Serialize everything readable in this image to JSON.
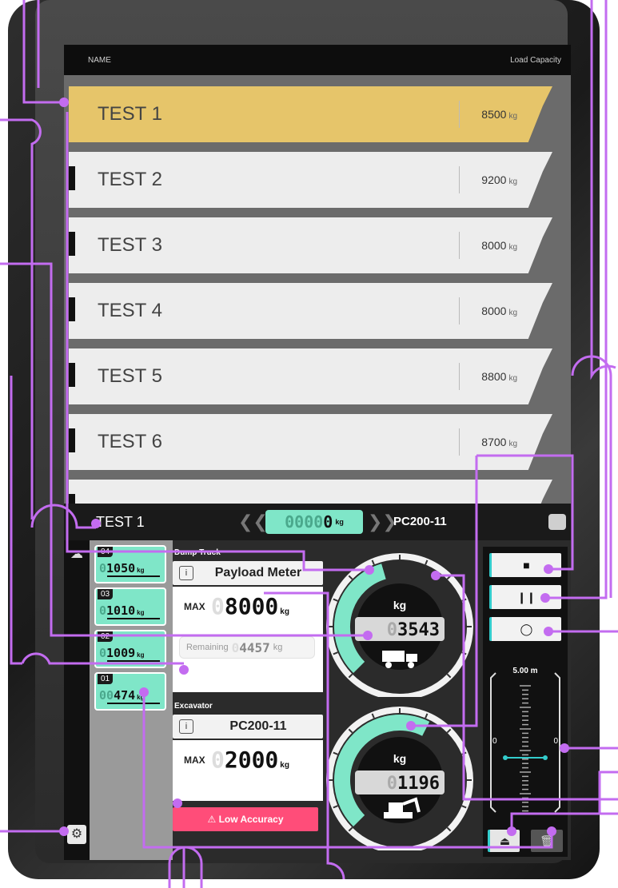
{
  "list": {
    "header_name": "NAME",
    "header_capacity": "Load Capacity",
    "unit": "kg",
    "rows": [
      {
        "name": "TEST 1",
        "capacity": "8500",
        "selected": true
      },
      {
        "name": "TEST 2",
        "capacity": "9200",
        "selected": false
      },
      {
        "name": "TEST 3",
        "capacity": "8000",
        "selected": false
      },
      {
        "name": "TEST 4",
        "capacity": "8000",
        "selected": false
      },
      {
        "name": "TEST 5",
        "capacity": "8800",
        "selected": false
      },
      {
        "name": "TEST 6",
        "capacity": "8700",
        "selected": false
      }
    ]
  },
  "statusbar": {
    "selected_name": "TEST 1",
    "current_weight": "0",
    "weight_ghost": "0000",
    "unit": "kg",
    "machine": "PC200-11"
  },
  "loads": [
    {
      "index": "04",
      "ghost": "0",
      "value": "1050",
      "unit": "kg"
    },
    {
      "index": "03",
      "ghost": "0",
      "value": "1010",
      "unit": "kg"
    },
    {
      "index": "02",
      "ghost": "0",
      "value": "1009",
      "unit": "kg"
    },
    {
      "index": "01",
      "ghost": "00",
      "value": "474",
      "unit": "kg"
    }
  ],
  "dump_truck": {
    "section_label": "Dump Truck",
    "title": "Payload Meter",
    "max_label": "MAX",
    "max_ghost": "0",
    "max_value": "8000",
    "unit": "kg",
    "remaining_label": "Remaining",
    "remaining_ghost": "0",
    "remaining_value": "4457",
    "remaining_unit": "kg",
    "gauge_unit": "kg",
    "gauge_ghost": "0",
    "gauge_value": "3543",
    "fill_fraction": 0.44
  },
  "excavator": {
    "section_label": "Excavator",
    "title": "PC200-11",
    "max_label": "MAX",
    "max_ghost": "0",
    "max_value": "2000",
    "unit": "kg",
    "warning": "Low Accuracy",
    "gauge_unit": "kg",
    "gauge_ghost": "0",
    "gauge_value": "1196",
    "fill_fraction": 0.6
  },
  "controls": {
    "stop_icon": "stop-icon",
    "pause_icon": "pause-icon",
    "gauge_icon": "gauge-reset-icon",
    "height_label": "5.00  m",
    "left_zero": "0",
    "right_zero": "0",
    "eject_icon": "eject-icon",
    "delete_icon": "trash-icon"
  },
  "colors": {
    "accent": "#7fe6c8",
    "selected_row": "#e6c56a",
    "warning": "#ff4d79",
    "callout": "#c36cf0"
  }
}
